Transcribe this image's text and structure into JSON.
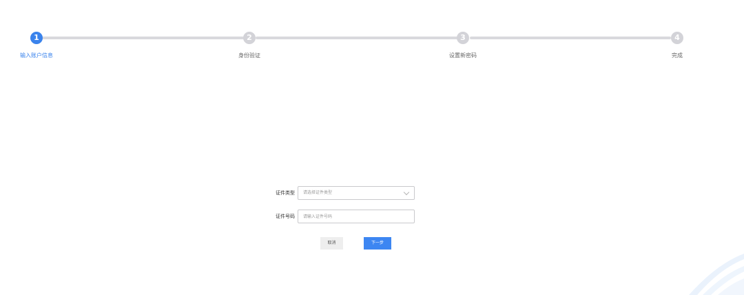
{
  "steps": [
    {
      "number": "1",
      "label": "输入账户信息",
      "active": true
    },
    {
      "number": "2",
      "label": "身份验证",
      "active": false
    },
    {
      "number": "3",
      "label": "设置新密码",
      "active": false
    },
    {
      "number": "4",
      "label": "完成",
      "active": false
    }
  ],
  "form": {
    "id_type": {
      "label": "证件类型",
      "placeholder": "请选择证件类型"
    },
    "id_number": {
      "label": "证件号码",
      "placeholder": "请输入证件号码"
    }
  },
  "buttons": {
    "cancel": "取消",
    "next": "下一步"
  },
  "colors": {
    "accent": "#3a83ec",
    "inactive_step": "#d3d3d8",
    "line": "#d9d9dd"
  },
  "icons": {
    "select_arrow": "chevron-down-icon"
  }
}
